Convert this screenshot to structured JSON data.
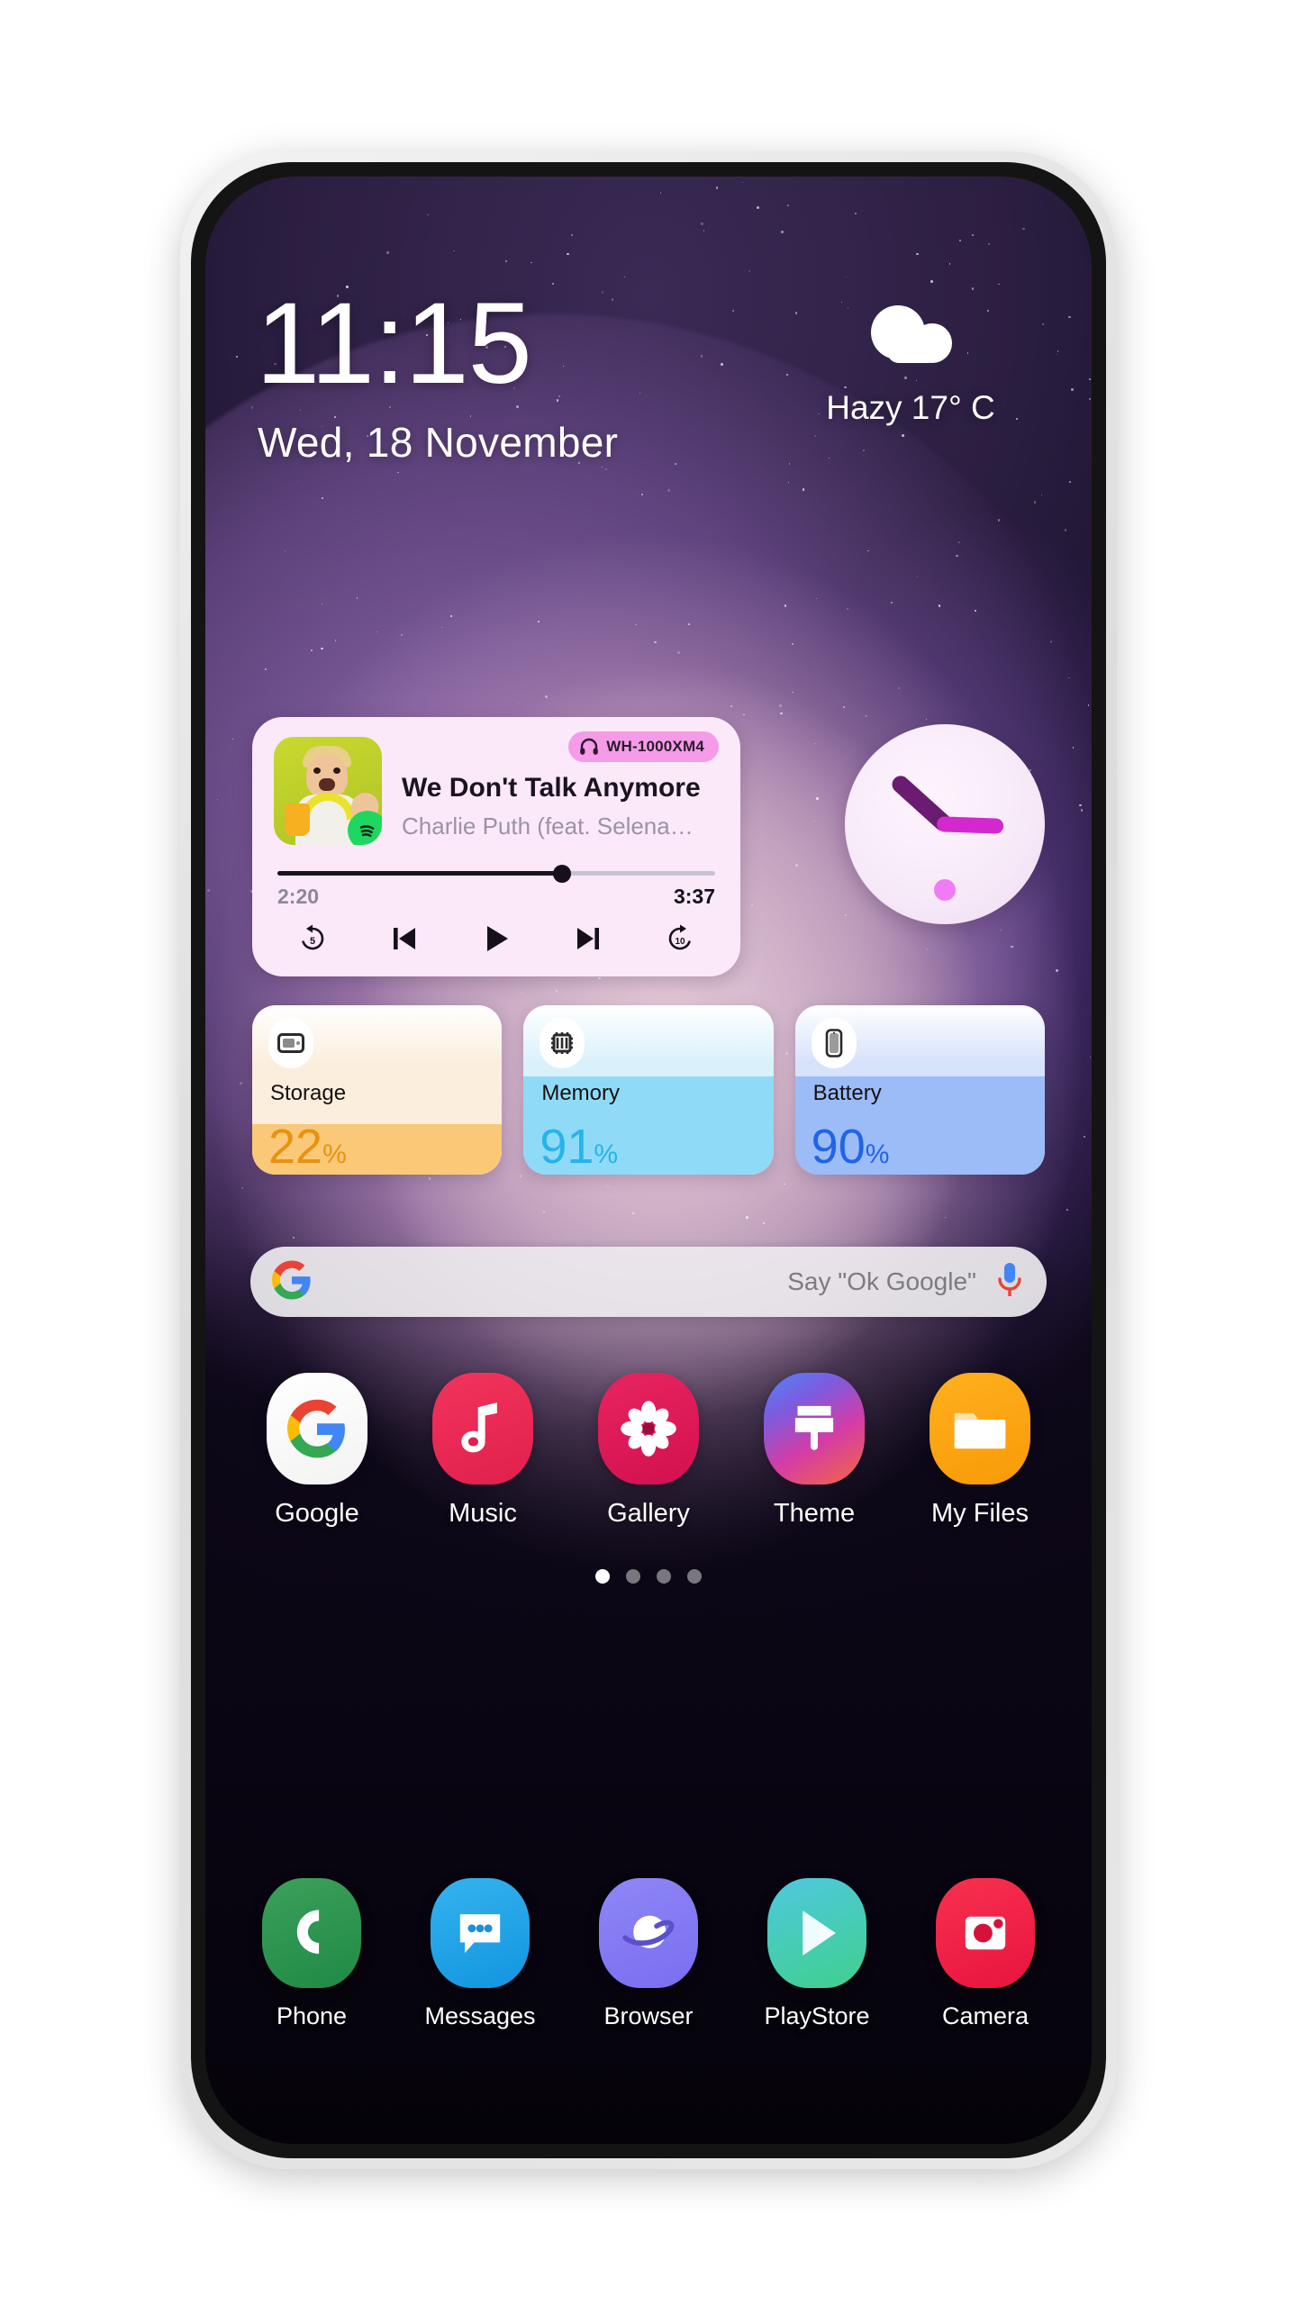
{
  "status": {
    "time": "11:15",
    "date": "Wed, 18 November",
    "weather_text": "Hazy 17° C",
    "weather_icon": "cloud-icon"
  },
  "music_widget": {
    "track_title": "We Don't Talk Anymore",
    "track_artist": "Charlie Puth (feat. Selena…",
    "device_badge": "WH-1000XM4",
    "device_icon": "headphones-icon",
    "source_icon": "spotify-icon",
    "elapsed": "2:20",
    "total": "3:37",
    "progress_percent": 64,
    "controls": [
      {
        "name": "rewind-5-button",
        "glyph": "5"
      },
      {
        "name": "previous-track-button",
        "glyph": ""
      },
      {
        "name": "play-button",
        "glyph": ""
      },
      {
        "name": "next-track-button",
        "glyph": ""
      },
      {
        "name": "forward-10-button",
        "glyph": "10"
      }
    ]
  },
  "analog_clock": {
    "name": "analog-clock-widget",
    "hour_angle": -48,
    "minute_angle": 92,
    "face_color": "#f7eaf8",
    "hour_hand_color": "#6b1b72",
    "minute_hand_color": "#d428cf"
  },
  "stats": [
    {
      "label": "Storage",
      "value": "22",
      "unit": "%",
      "percent": 22,
      "icon": "storage-card-icon",
      "bg_color": "#fceedd",
      "fill_color": "#f9c978",
      "text_color": "#e8920f"
    },
    {
      "label": "Memory",
      "value": "91",
      "unit": "%",
      "percent": 91,
      "icon": "memory-chip-icon",
      "bg_color": "#d9f1fb",
      "fill_color": "#8fdbf7",
      "text_color": "#27b3ea"
    },
    {
      "label": "Battery",
      "value": "90",
      "unit": "%",
      "percent": 90,
      "icon": "battery-phone-icon",
      "bg_color": "#d7e2fb",
      "fill_color": "#9bbcf7",
      "text_color": "#2064e8"
    }
  ],
  "search": {
    "placeholder": "Say \"Ok Google\"",
    "logo_icon": "google-g-icon",
    "mic_icon": "microphone-icon"
  },
  "apps": [
    {
      "label": "Google",
      "icon": "google-app-icon"
    },
    {
      "label": "Music",
      "icon": "music-note-icon"
    },
    {
      "label": "Gallery",
      "icon": "gallery-flower-icon"
    },
    {
      "label": "Theme",
      "icon": "theme-brush-icon"
    },
    {
      "label": "My Files",
      "icon": "my-files-folder-icon"
    }
  ],
  "page_dots": {
    "count": 4,
    "active_index": 0
  },
  "dock": [
    {
      "label": "Phone",
      "icon": "phone-handset-icon"
    },
    {
      "label": "Messages",
      "icon": "message-bubble-icon"
    },
    {
      "label": "Browser",
      "icon": "browser-planet-icon"
    },
    {
      "label": "PlayStore",
      "icon": "play-triangle-icon"
    },
    {
      "label": "Camera",
      "icon": "camera-icon"
    }
  ]
}
